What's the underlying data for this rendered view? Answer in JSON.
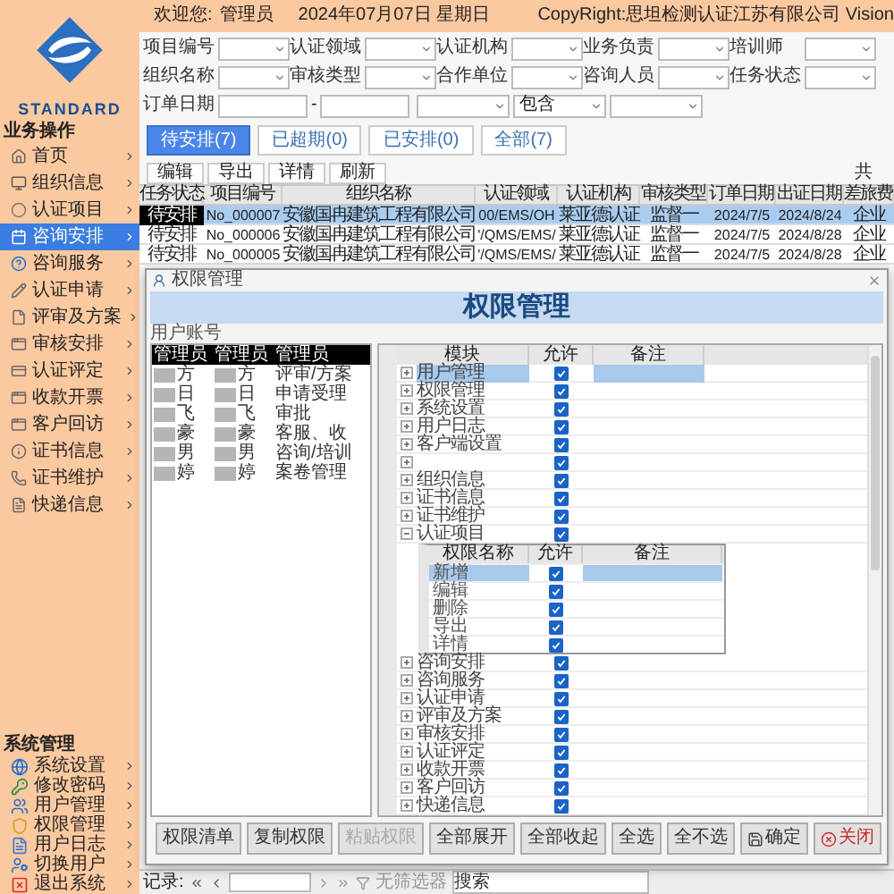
{
  "header": {
    "welcome_label": "欢迎您:",
    "user": "管理员",
    "date": "2024年07月07日 星期日",
    "copyright": "CopyRight:思坦检测认证江苏有限公司 Vision"
  },
  "logo": {
    "text": "STANDARD"
  },
  "sidebar": {
    "sections": [
      {
        "title": "业务操作",
        "kind": "business",
        "items": [
          {
            "label": "首页",
            "selected": false
          },
          {
            "label": "组织信息",
            "selected": false
          },
          {
            "label": "认证项目",
            "selected": false
          },
          {
            "label": "咨询安排",
            "selected": true
          },
          {
            "label": "咨询服务",
            "selected": false
          },
          {
            "label": "认证申请",
            "selected": false
          },
          {
            "label": "评审及方案",
            "selected": false
          },
          {
            "label": "审核安排",
            "selected": false
          },
          {
            "label": "认证评定",
            "selected": false
          },
          {
            "label": "收款开票",
            "selected": false
          },
          {
            "label": "客户回访",
            "selected": false
          },
          {
            "label": "证书信息",
            "selected": false
          },
          {
            "label": "证书维护",
            "selected": false
          },
          {
            "label": "快递信息",
            "selected": false
          }
        ]
      },
      {
        "title": "系统管理",
        "kind": "system",
        "items": [
          {
            "label": "系统设置",
            "selected": false
          },
          {
            "label": "修改密码",
            "selected": false
          },
          {
            "label": "用户管理",
            "selected": false
          },
          {
            "label": "权限管理",
            "selected": false
          },
          {
            "label": "用户日志",
            "selected": false
          },
          {
            "label": "切换用户",
            "selected": false
          },
          {
            "label": "退出系统",
            "selected": false
          }
        ]
      }
    ]
  },
  "filters": {
    "rows": [
      [
        {
          "kind": "select",
          "label": "项目编号"
        },
        {
          "kind": "select",
          "label": "认证领域"
        },
        {
          "kind": "select",
          "label": "认证机构"
        },
        {
          "kind": "select",
          "label": "业务负责"
        },
        {
          "kind": "select",
          "label": "培训师"
        }
      ],
      [
        {
          "kind": "select",
          "label": "组织名称"
        },
        {
          "kind": "select",
          "label": "审核类型"
        },
        {
          "kind": "select",
          "label": "合作单位"
        },
        {
          "kind": "select",
          "label": "咨询人员"
        },
        {
          "kind": "select",
          "label": "任务状态"
        }
      ],
      [
        {
          "kind": "date_range",
          "label": "订单日期",
          "separator": "-"
        },
        {
          "kind": "select"
        },
        {
          "kind": "select",
          "value": "包含"
        },
        {
          "kind": "select"
        }
      ]
    ]
  },
  "tabs": [
    {
      "label": "待安排(7)",
      "selected": true
    },
    {
      "label": "已超期(0)",
      "selected": false
    },
    {
      "label": "已安排(0)",
      "selected": false
    },
    {
      "label": "全部(7)",
      "selected": false
    }
  ],
  "toolbar": {
    "buttons": [
      "编辑",
      "导出",
      "详情",
      "刷新"
    ],
    "total_label": "共"
  },
  "table": {
    "columns": [
      {
        "label": "任务状态",
        "kind": "text"
      },
      {
        "label": "项目编号",
        "kind": "code"
      },
      {
        "label": "组织名称",
        "kind": "text"
      },
      {
        "label": "认证领域",
        "kind": "code"
      },
      {
        "label": "认证机构",
        "kind": "text"
      },
      {
        "label": "审核类型",
        "kind": "text"
      },
      {
        "label": "订单日期",
        "kind": "code"
      },
      {
        "label": "出证日期",
        "kind": "code"
      },
      {
        "label": "差旅费",
        "kind": "text"
      }
    ],
    "rows": [
      {
        "selected": true,
        "cells": [
          "待安排",
          "No_000007",
          "安徽国冉建筑工程有限公司",
          "00/EMS/OH",
          "莱亚德认证",
          "监督一",
          "2024/7/5",
          "2024/8/24",
          "企业"
        ]
      },
      {
        "selected": false,
        "cells": [
          "待安排",
          "No_000006",
          "安徽国冉建筑工程有限公司",
          "'/QMS/EMS/",
          "莱亚德认证",
          "监督一",
          "2024/7/5",
          "2024/8/28",
          "企业"
        ]
      },
      {
        "selected": false,
        "cells": [
          "待安排",
          "No_000005",
          "安徽国冉建筑工程有限公司",
          "'/QMS/EMS/",
          "莱亚德认证",
          "监督一",
          "2024/7/5",
          "2024/8/28",
          "企业"
        ]
      }
    ]
  },
  "dialog": {
    "title": "权限管理",
    "heading": "权限管理",
    "account_label": "用户账号",
    "users": {
      "columns": [
        {
          "label": "管理员",
          "redacted": true
        },
        {
          "label": "管理员",
          "redacted": true
        },
        {
          "label": "管理员",
          "redacted": false
        }
      ],
      "rows": [
        [
          "方",
          "方",
          "评审/方案"
        ],
        [
          "日",
          "日",
          "申请受理"
        ],
        [
          "飞",
          "飞",
          "审批"
        ],
        [
          "豪",
          "豪",
          "客服、收"
        ],
        [
          "男",
          "男",
          "咨询/培训"
        ],
        [
          "婷",
          "婷",
          "案卷管理"
        ]
      ]
    },
    "modules": {
      "columns": [
        "模块",
        "允许",
        "备注"
      ],
      "rows": [
        {
          "name": "用户管理",
          "allowed": true,
          "selected": true,
          "expanded": false
        },
        {
          "name": "权限管理",
          "allowed": true,
          "selected": false,
          "expanded": false
        },
        {
          "name": "系统设置",
          "allowed": true,
          "selected": false,
          "expanded": false
        },
        {
          "name": "用户日志",
          "allowed": true,
          "selected": false,
          "expanded": false
        },
        {
          "name": "客户端设置",
          "allowed": true,
          "selected": false,
          "expanded": false
        },
        {
          "allowed": true,
          "selected": false,
          "expanded": false
        },
        {
          "name": "组织信息",
          "allowed": true,
          "selected": false,
          "expanded": false
        },
        {
          "name": "证书信息",
          "allowed": true,
          "selected": false,
          "expanded": false
        },
        {
          "name": "证书维护",
          "allowed": true,
          "selected": false,
          "expanded": false
        },
        {
          "name": "认证项目",
          "allowed": true,
          "selected": false,
          "expanded": true,
          "children": {
            "columns": [
              "权限名称",
              "允许",
              "备注"
            ],
            "rows": [
              {
                "name": "新增",
                "allowed": true,
                "selected": true
              },
              {
                "name": "编辑",
                "allowed": true,
                "selected": false
              },
              {
                "name": "删除",
                "allowed": true,
                "selected": false
              },
              {
                "name": "导出",
                "allowed": true,
                "selected": false
              },
              {
                "name": "详情",
                "allowed": true,
                "selected": false
              }
            ]
          }
        },
        {
          "name": "咨询安排",
          "allowed": true,
          "selected": false,
          "expanded": false
        },
        {
          "name": "咨询服务",
          "allowed": true,
          "selected": false,
          "expanded": false
        },
        {
          "name": "认证申请",
          "allowed": true,
          "selected": false,
          "expanded": false
        },
        {
          "name": "评审及方案",
          "allowed": true,
          "selected": false,
          "expanded": false
        },
        {
          "name": "审核安排",
          "allowed": true,
          "selected": false,
          "expanded": false
        },
        {
          "name": "认证评定",
          "allowed": true,
          "selected": false,
          "expanded": false
        },
        {
          "name": "收款开票",
          "allowed": true,
          "selected": false,
          "expanded": false
        },
        {
          "name": "客户回访",
          "allowed": true,
          "selected": false,
          "expanded": false
        },
        {
          "name": "快递信息",
          "allowed": true,
          "selected": false,
          "expanded": false
        }
      ]
    },
    "buttons": [
      {
        "label": "权限清单",
        "kind": "plain",
        "disabled": false
      },
      {
        "label": "复制权限",
        "kind": "plain",
        "disabled": false
      },
      {
        "label": "粘贴权限",
        "kind": "plain",
        "disabled": true
      },
      {
        "label": "全部展开",
        "kind": "plain",
        "disabled": false
      },
      {
        "label": "全部收起",
        "kind": "plain",
        "disabled": false
      },
      {
        "label": "全选",
        "kind": "plain",
        "disabled": false
      },
      {
        "label": "全不选",
        "kind": "plain",
        "disabled": false
      },
      {
        "label": "确定",
        "kind": "confirm",
        "disabled": false
      },
      {
        "label": "关闭",
        "kind": "close",
        "disabled": false
      }
    ]
  },
  "status_bar": {
    "record_label": "记录:",
    "filter_label": "无筛选器",
    "search_placeholder": "搜索"
  }
}
